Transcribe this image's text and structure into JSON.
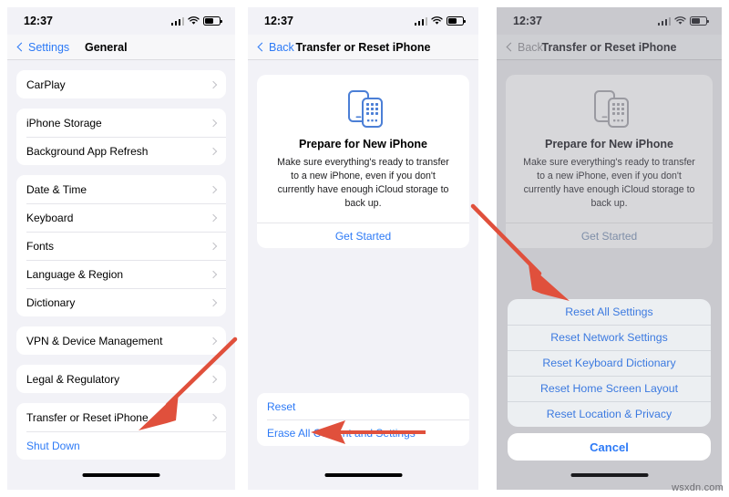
{
  "status_bar": {
    "time": "12:37",
    "signal_icon": "cellular-signal-icon",
    "wifi_icon": "wifi-icon",
    "battery_icon": "battery-icon"
  },
  "colors": {
    "accent_blue": "#2d7af6",
    "arrow_red": "#e0503c",
    "panel_bg": "#f2f2f7",
    "dim_bg": "#c9c9ce"
  },
  "panel1": {
    "nav": {
      "back_label": "Settings",
      "title": "General"
    },
    "groups": [
      {
        "rows": [
          {
            "label": "CarPlay",
            "type": "chevron"
          }
        ]
      },
      {
        "rows": [
          {
            "label": "iPhone Storage",
            "type": "chevron"
          },
          {
            "label": "Background App Refresh",
            "type": "chevron"
          }
        ]
      },
      {
        "rows": [
          {
            "label": "Date & Time",
            "type": "chevron"
          },
          {
            "label": "Keyboard",
            "type": "chevron"
          },
          {
            "label": "Fonts",
            "type": "chevron"
          },
          {
            "label": "Language & Region",
            "type": "chevron"
          },
          {
            "label": "Dictionary",
            "type": "chevron"
          }
        ]
      },
      {
        "rows": [
          {
            "label": "VPN & Device Management",
            "type": "chevron"
          }
        ]
      },
      {
        "rows": [
          {
            "label": "Legal & Regulatory",
            "type": "chevron"
          }
        ]
      },
      {
        "rows": [
          {
            "label": "Transfer or Reset iPhone",
            "type": "chevron"
          },
          {
            "label": "Shut Down",
            "type": "link"
          }
        ]
      }
    ]
  },
  "panel2": {
    "nav": {
      "back_label": "Back",
      "title": "Transfer or Reset iPhone"
    },
    "card": {
      "icon": "two-iphones-icon",
      "title": "Prepare for New iPhone",
      "description": "Make sure everything's ready to transfer to a new iPhone, even if you don't currently have enough iCloud storage to back up.",
      "action_label": "Get Started"
    },
    "bottom_rows": [
      {
        "label": "Reset"
      },
      {
        "label": "Erase All Content and Settings"
      }
    ]
  },
  "panel3": {
    "nav": {
      "back_label": "Back",
      "title": "Transfer or Reset iPhone"
    },
    "card": {
      "icon": "two-iphones-icon",
      "title": "Prepare for New iPhone",
      "description": "Make sure everything's ready to transfer to a new iPhone, even if you don't currently have enough iCloud storage to back up.",
      "action_label": "Get Started"
    },
    "action_sheet": {
      "items": [
        {
          "label": "Reset All Settings"
        },
        {
          "label": "Reset Network Settings"
        },
        {
          "label": "Reset Keyboard Dictionary"
        },
        {
          "label": "Reset Home Screen Layout"
        },
        {
          "label": "Reset Location & Privacy"
        }
      ],
      "cancel_label": "Cancel"
    }
  },
  "annotations": {
    "arrow1": "arrow-pointing-to-transfer-or-reset-iphone",
    "arrow2": "arrow-pointing-to-reset",
    "arrow3": "arrow-pointing-to-reset-all-settings"
  },
  "watermark": {
    "text": "wsxdn.com"
  }
}
